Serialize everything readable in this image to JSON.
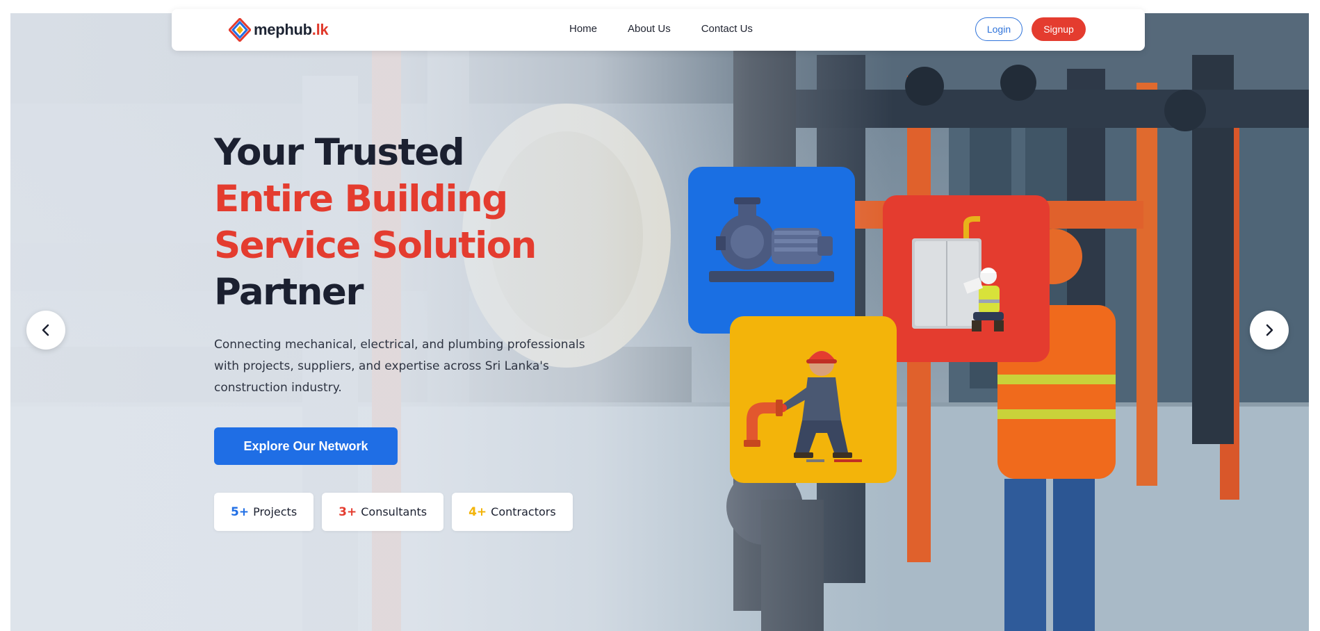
{
  "brand": {
    "name": "mephub",
    "tld": ".lk",
    "logo_icon": "mephub-diamond-logo",
    "colors": {
      "primary": "#1f6ee5",
      "accent": "#e43c2f",
      "yellow": "#f3b40a",
      "dark": "#1b2030"
    }
  },
  "nav": {
    "links": [
      {
        "label": "Home"
      },
      {
        "label": "About Us"
      },
      {
        "label": "Contact Us"
      }
    ],
    "login_label": "Login",
    "signup_label": "Signup"
  },
  "hero": {
    "headline": {
      "line1": "Your Trusted",
      "line2": "Entire Building",
      "line3": "Service Solution",
      "line4": "Partner"
    },
    "subtext": "Connecting mechanical, electrical, and plumbing professionals with projects, suppliers, and expertise across Sri Lanka's construction industry.",
    "cta_label": "Explore Our Network",
    "stats": [
      {
        "value": "5+",
        "label": "Projects",
        "color": "#1f6ee5"
      },
      {
        "value": "3+",
        "label": "Consultants",
        "color": "#e43c2f"
      },
      {
        "value": "4+",
        "label": "Contractors",
        "color": "#f3b40a"
      }
    ],
    "tiles": [
      {
        "icon": "water-pump-icon",
        "color": "#1a6fe3"
      },
      {
        "icon": "generator-engineer-icon",
        "color": "#e43c2f"
      },
      {
        "icon": "plumber-worker-icon",
        "color": "#f3b40a"
      }
    ]
  },
  "carousel": {
    "prev_icon": "chevron-left-icon",
    "next_icon": "chevron-right-icon"
  }
}
